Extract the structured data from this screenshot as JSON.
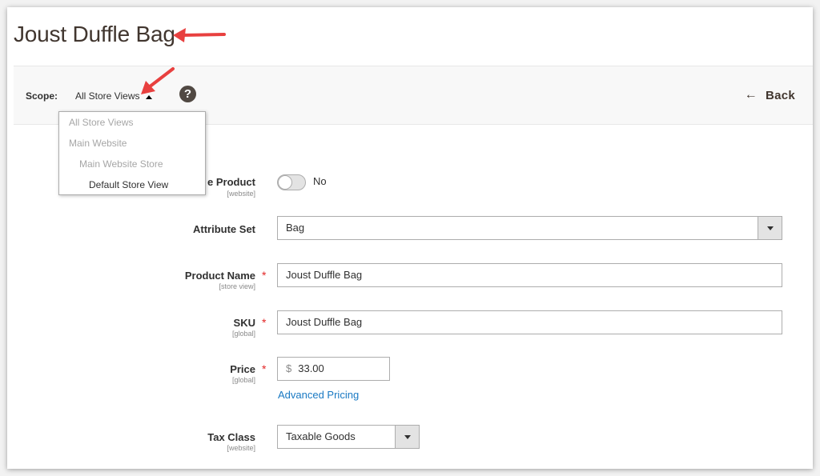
{
  "page": {
    "title": "Joust Duffle Bag"
  },
  "scope_bar": {
    "label": "Scope:",
    "current": "All Store Views",
    "help_icon": "?",
    "back_label": "Back",
    "back_icon": "←"
  },
  "scope_dropdown": {
    "options": [
      {
        "label": "All Store Views",
        "level": 0,
        "enabled": false
      },
      {
        "label": "Main Website",
        "level": 0,
        "enabled": false
      },
      {
        "label": "Main Website Store",
        "level": 1,
        "enabled": false
      },
      {
        "label": "Default Store View",
        "level": 2,
        "enabled": true
      }
    ]
  },
  "form": {
    "enable_product": {
      "label": "Enable Product",
      "visible_label": "e Product",
      "scope": "[website]",
      "value": "No"
    },
    "attribute_set": {
      "label": "Attribute Set",
      "value": "Bag"
    },
    "product_name": {
      "label": "Product Name",
      "scope": "[store view]",
      "required": "*",
      "value": "Joust Duffle Bag"
    },
    "sku": {
      "label": "SKU",
      "scope": "[global]",
      "required": "*",
      "value": "Joust Duffle Bag"
    },
    "price": {
      "label": "Price",
      "scope": "[global]",
      "required": "*",
      "currency": "$",
      "value": "33.00",
      "advanced_link": "Advanced Pricing"
    },
    "tax_class": {
      "label": "Tax Class",
      "scope": "[website]",
      "value": "Taxable Goods"
    }
  },
  "annotations": {
    "arrow_color": "#e8403f"
  }
}
